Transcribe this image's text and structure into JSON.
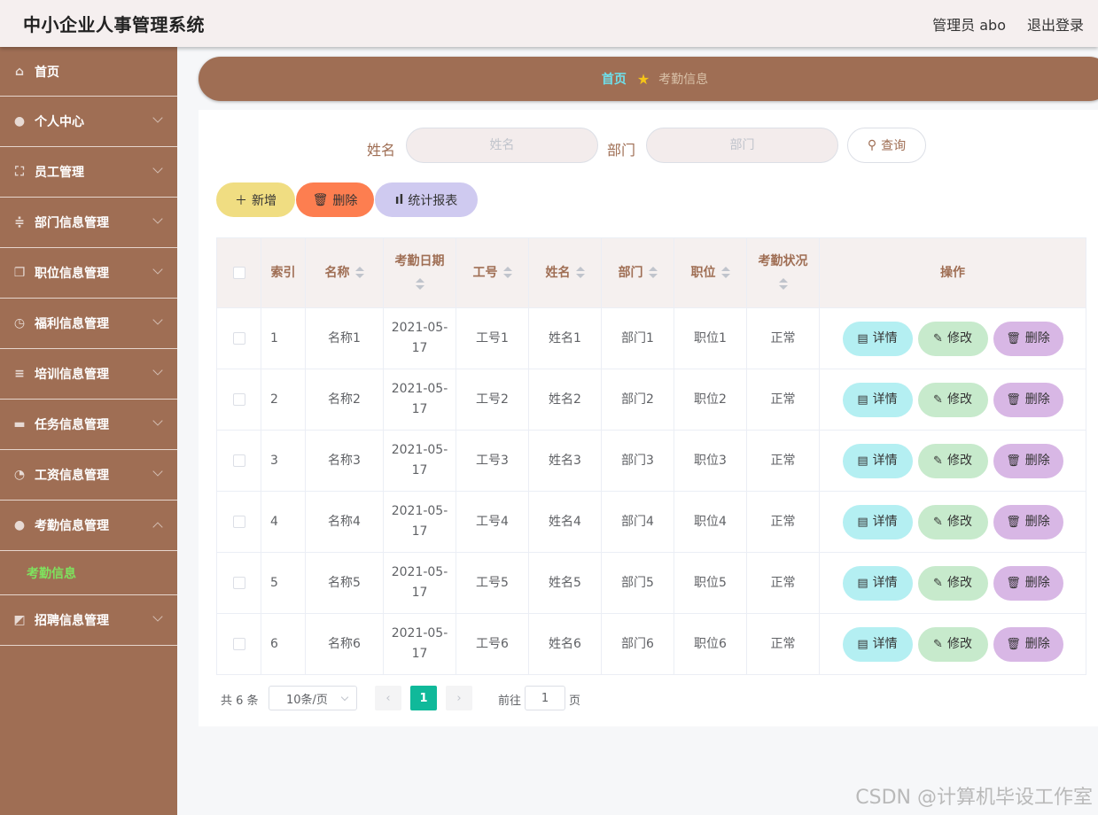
{
  "header": {
    "title": "中小企业人事管理系统",
    "user": "管理员 abo",
    "logout": "退出登录"
  },
  "sidebar": {
    "items": [
      {
        "label": "首页",
        "icon": "home-icon",
        "glyph": "⌂"
      },
      {
        "label": "个人中心",
        "icon": "user-icon",
        "glyph": "●"
      },
      {
        "label": "员工管理",
        "icon": "frame-icon",
        "glyph": "⛶"
      },
      {
        "label": "部门信息管理",
        "icon": "sliders-icon",
        "glyph": "≑"
      },
      {
        "label": "职位信息管理",
        "icon": "copy-icon",
        "glyph": "❐"
      },
      {
        "label": "福利信息管理",
        "icon": "clock-icon",
        "glyph": "◷"
      },
      {
        "label": "培训信息管理",
        "icon": "list-icon",
        "glyph": "≡"
      },
      {
        "label": "任务信息管理",
        "icon": "monitor-icon",
        "glyph": "▬"
      },
      {
        "label": "工资信息管理",
        "icon": "gauge-icon",
        "glyph": "◔"
      },
      {
        "label": "考勤信息管理",
        "icon": "user-icon",
        "glyph": "●"
      },
      {
        "label": "招聘信息管理",
        "icon": "chart-icon",
        "glyph": "◩"
      }
    ],
    "submenu": {
      "label": "考勤信息"
    }
  },
  "breadcrumb": {
    "home": "首页",
    "current": "考勤信息"
  },
  "search": {
    "name_label": "姓名",
    "name_placeholder": "姓名",
    "dept_label": "部门",
    "dept_placeholder": "部门",
    "button": "查询"
  },
  "actions": {
    "add": "新增",
    "delete": "删除",
    "report": "统计报表"
  },
  "colors": {
    "sidebar": "#9f6e54",
    "add": "#f0dd82",
    "delete": "#fd7e50",
    "report": "#cfcaf0",
    "detail": "#b4eff2",
    "edit": "#c7eacc",
    "remove": "#d8b7e5",
    "accent": "#10b99a"
  },
  "table": {
    "columns": [
      "索引",
      "名称",
      "考勤日期",
      "工号",
      "姓名",
      "部门",
      "职位",
      "考勤状况",
      "操作"
    ],
    "rows": [
      [
        "1",
        "名称1",
        "2021-05-17",
        "工号1",
        "姓名1",
        "部门1",
        "职位1",
        "正常"
      ],
      [
        "2",
        "名称2",
        "2021-05-17",
        "工号2",
        "姓名2",
        "部门2",
        "职位2",
        "正常"
      ],
      [
        "3",
        "名称3",
        "2021-05-17",
        "工号3",
        "姓名3",
        "部门3",
        "职位3",
        "正常"
      ],
      [
        "4",
        "名称4",
        "2021-05-17",
        "工号4",
        "姓名4",
        "部门4",
        "职位4",
        "正常"
      ],
      [
        "5",
        "名称5",
        "2021-05-17",
        "工号5",
        "姓名5",
        "部门5",
        "职位5",
        "正常"
      ],
      [
        "6",
        "名称6",
        "2021-05-17",
        "工号6",
        "姓名6",
        "部门6",
        "职位6",
        "正常"
      ]
    ],
    "row_actions": {
      "detail": "详情",
      "edit": "修改",
      "remove": "删除"
    }
  },
  "pagination": {
    "total": "共 6 条",
    "page_size": "10条/页",
    "current": "1",
    "goto": "前往",
    "goto_value": "1",
    "page_unit": "页"
  },
  "watermark": "CSDN @计算机毕设工作室"
}
